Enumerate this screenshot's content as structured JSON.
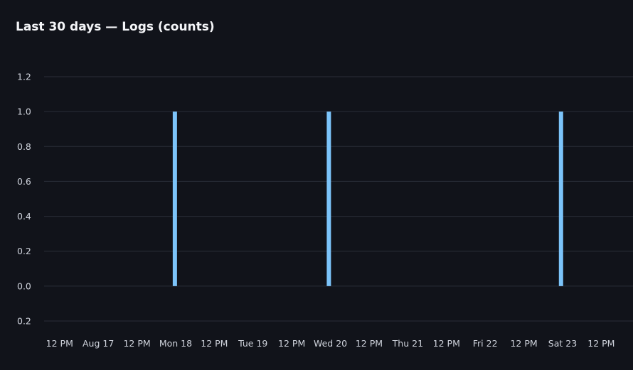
{
  "panel": {
    "title": "Last 30 days — Logs (counts)"
  },
  "chart_data": {
    "type": "bar",
    "title": "Last 30 days — Logs (counts)",
    "y_tick_labels": [
      "0.2",
      "0.0",
      "0.2",
      "0.4",
      "0.6",
      "0.8",
      "1.0",
      "1.2"
    ],
    "y_tick_values": [
      -0.2,
      0.0,
      0.2,
      0.4,
      0.6,
      0.8,
      1.0,
      1.2
    ],
    "ylim": [
      -0.2,
      1.2
    ],
    "x_tick_labels": [
      "12 PM",
      "Aug 17",
      "12 PM",
      "Mon 18",
      "12 PM",
      "Tue 19",
      "12 PM",
      "Wed 20",
      "12 PM",
      "Thu 21",
      "12 PM",
      "Fri 22",
      "12 PM",
      "Sat 23",
      "12 PM"
    ],
    "x_tick_values": [
      -0.5,
      0,
      0.5,
      1,
      1.5,
      2,
      2.5,
      3,
      3.5,
      4,
      4.5,
      5,
      5.5,
      6,
      6.5
    ],
    "xlim": [
      -0.7,
      6.8
    ],
    "bars": [
      {
        "x": 0.99,
        "label": "Mon 18",
        "value": 1
      },
      {
        "x": 2.98,
        "label": "Wed 20",
        "value": 1
      },
      {
        "x": 5.98,
        "label": "Sat 23",
        "value": 1
      }
    ],
    "grid": true,
    "colors": {
      "bar": "#7cc4fa",
      "grid": "#2a2e38",
      "background": "#11131a"
    }
  }
}
